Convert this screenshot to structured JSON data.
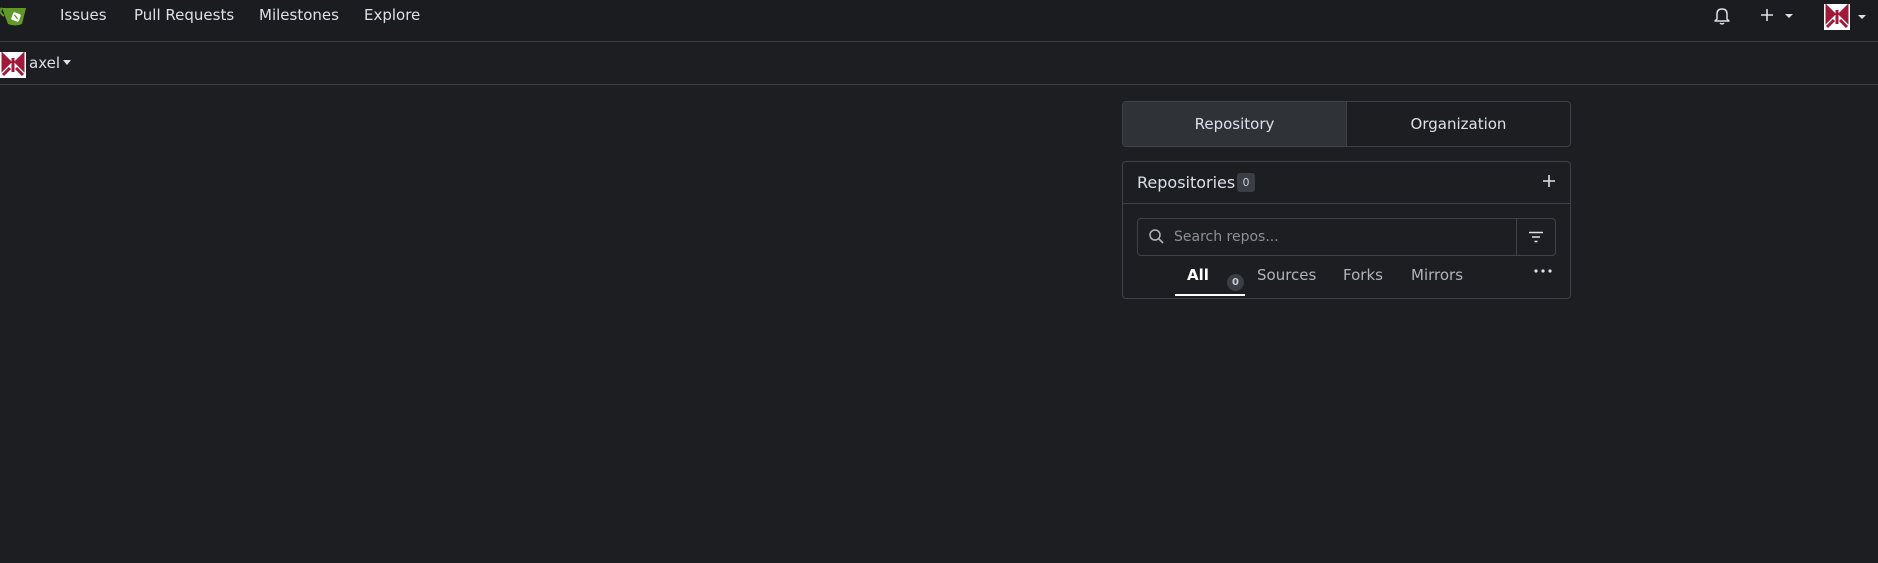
{
  "navbar": {
    "links": [
      "Issues",
      "Pull Requests",
      "Milestones",
      "Explore"
    ]
  },
  "context": {
    "username": "axel"
  },
  "switcher": {
    "repository": "Repository",
    "organization": "Organization"
  },
  "repos": {
    "title": "Repositories",
    "count": "0",
    "search_placeholder": "Search repos...",
    "tabs": {
      "all": "All",
      "all_count": "0",
      "sources": "Sources",
      "forks": "Forks",
      "mirrors": "Mirrors"
    }
  },
  "colors": {
    "background": "#1c1e21",
    "logo": "#609926",
    "avatar": "#a0183a"
  }
}
